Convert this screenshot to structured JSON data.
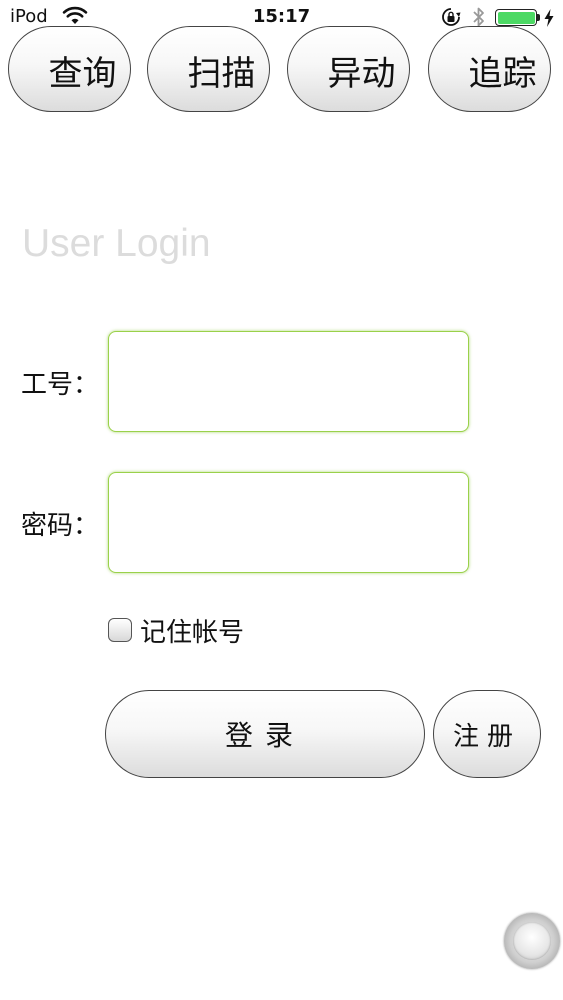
{
  "status_bar": {
    "carrier": "iPod",
    "time": "15:17",
    "battery_level_percent": 100,
    "icons": [
      "wifi-icon",
      "orientation-lock-icon",
      "bluetooth-icon",
      "battery-icon",
      "charging-icon"
    ],
    "battery_color": "#4cd964"
  },
  "nav": {
    "buttons": [
      {
        "label": "查询"
      },
      {
        "label": "扫描"
      },
      {
        "label": "异动"
      },
      {
        "label": "追踪"
      }
    ]
  },
  "login": {
    "title": "User Login",
    "employee_id_label": "工号：",
    "employee_id_value": "",
    "password_label": "密码：",
    "password_value": "",
    "remember_label": "记住帐号",
    "remember_checked": false,
    "login_button": "登录",
    "register_button": "注册"
  },
  "colors": {
    "field_border": "#9ad14a",
    "title_color": "#dcdcdc"
  }
}
